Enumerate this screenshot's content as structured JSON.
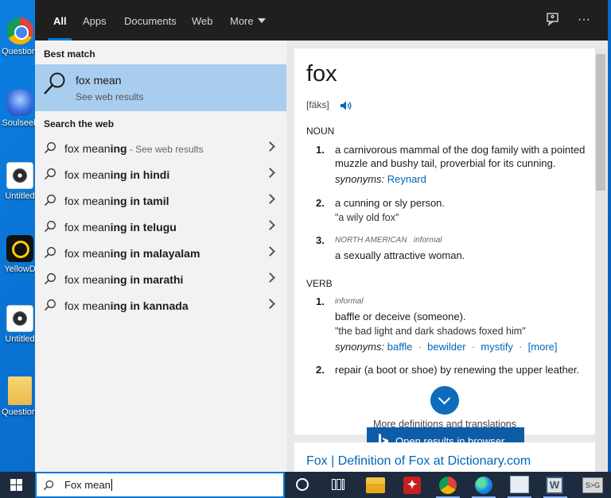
{
  "desktop": {
    "icons": [
      {
        "icon": "chrome-icon",
        "label": "Question Help - In"
      },
      {
        "icon": "soulseek-icon",
        "label": "Soulseek"
      },
      {
        "icon": "disc-icon",
        "label": "Untitled"
      },
      {
        "icon": "yellowdot-icon",
        "label": "YellowD"
      },
      {
        "icon": "disc-icon",
        "label": "Untitled"
      },
      {
        "icon": "folder-icon",
        "label": "Question Help - In"
      }
    ]
  },
  "tabs": [
    {
      "label": "All"
    },
    {
      "label": "Apps"
    },
    {
      "label": "Documents"
    },
    {
      "label": "Web"
    },
    {
      "label": "More"
    }
  ],
  "left": {
    "best_match_header": "Best match",
    "best_match": {
      "title": "fox mean",
      "subtitle": "See web results"
    },
    "search_web_header": "Search the web",
    "suggestions": [
      {
        "prefix": "fox mean",
        "bold": "ing",
        "suffix": " - See web results"
      },
      {
        "prefix": "fox mean",
        "bold": "ing in hindi",
        "suffix": ""
      },
      {
        "prefix": "fox mean",
        "bold": "ing in tamil",
        "suffix": ""
      },
      {
        "prefix": "fox mean",
        "bold": "ing in telugu",
        "suffix": ""
      },
      {
        "prefix": "fox mean",
        "bold": "ing in malayalam",
        "suffix": ""
      },
      {
        "prefix": "fox mean",
        "bold": "ing in marathi",
        "suffix": ""
      },
      {
        "prefix": "fox mean",
        "bold": "ing in kannada",
        "suffix": ""
      }
    ]
  },
  "dictionary": {
    "word": "fox",
    "pronunciation": "[fäks]",
    "noun_label": "NOUN",
    "noun": [
      {
        "num": "1.",
        "definition": "a carnivorous mammal of the dog family with a pointed muzzle and bushy tail, proverbial for its cunning.",
        "synonyms_label": "synonyms:",
        "synonyms": [
          "Reynard"
        ]
      },
      {
        "num": "2.",
        "definition": "a cunning or sly person.",
        "example": "\"a wily old fox\""
      },
      {
        "num": "3.",
        "region": "NORTH AMERICAN",
        "register": "informal",
        "definition": "a sexually attractive woman."
      }
    ],
    "verb_label": "VERB",
    "verb": [
      {
        "num": "1.",
        "register": "informal",
        "definition": "baffle or deceive (someone).",
        "example": "\"the bad light and dark shadows foxed him\"",
        "synonyms_label": "synonyms:",
        "synonyms": [
          "baffle",
          "bewilder",
          "mystify",
          "[more]"
        ]
      },
      {
        "num": "2.",
        "definition": "repair (a boot or shoe) by renewing the upper leather."
      }
    ],
    "more_label": "More definitions and translations",
    "open_button": "Open results in browser",
    "result_link": "Fox | Definition of Fox at Dictionary.com"
  },
  "taskbar": {
    "search_value": "Fox mean"
  },
  "colors": {
    "accent": "#0078d4",
    "link": "#0067b8",
    "best_match_bg": "#a9cdee",
    "topbar_bg": "#1f1f1f"
  }
}
